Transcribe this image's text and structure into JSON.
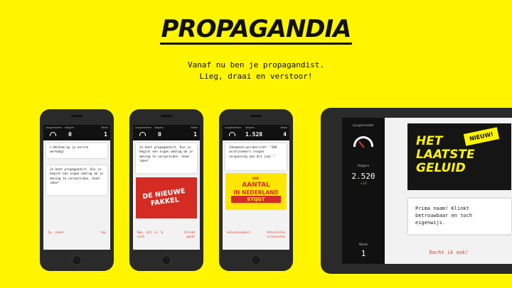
{
  "header": {
    "logo": "PROPAGANDIA",
    "tagline_line1": "Vanaf nu ben je propagandist.",
    "tagline_line2": "Lieg, draai en verstoor!"
  },
  "phones": [
    {
      "stats": {
        "leugenmeter_label": "Leugenmeter",
        "volgers_label": "Volgers",
        "volgers_value": "0",
        "week_label": "Week",
        "week_value": "1"
      },
      "cards": [
        "☺ Welkom op je eerste werkdag!",
        "Je bent propagandist. Dus je begint een eigen weblog om je mening te verspreiden. Goed idee?"
      ],
      "actions": {
        "left": "Ja, zeker",
        "right": "Yep"
      }
    },
    {
      "stats": {
        "leugenmeter_label": "Leugenmeter",
        "volgers_label": "Volgers",
        "volgers_value": "0",
        "week_label": "Week",
        "week_value": "1"
      },
      "cards": [
        "Je bent propagandist. Dus je begint een eigen weblog om je mening te verspreiden. Goed idee?"
      ],
      "poster": {
        "line1": "DE NIEUWE",
        "line2": "FAKKEL"
      },
      "actions": {
        "left": "Nee, dit is 'm niet",
        "right": "Klinkt goed!"
      }
    },
    {
      "stats": {
        "leugenmeter_label": "Leugenmeter",
        "volgers_label": "Volgers",
        "volgers_value": "1.528",
        "week_label": "Week",
        "week_value": "4"
      },
      "cards": [
        "Inkomend persbericht! \"300 asielzoekers vragen vergunning aan dit jaar.\""
      ],
      "poster": {
        "tag": "DNF",
        "line1": "AANTAL",
        "line2": "IN NEDERLAND",
        "line3": "STIJGT"
      },
      "actions": {
        "left": "Geluckzoekers",
        "right": "Potentiële criminelen"
      }
    }
  ],
  "tablet": {
    "leugenmeter_label": "Leugenmeter",
    "volgers_label": "Volgers",
    "volgers_value": "2.520",
    "volgers_delta": "+10",
    "week_label": "Week",
    "week_value": "1",
    "poster": {
      "line1": "HET",
      "line2": "LAATSTE",
      "line3": "GELUID",
      "badge": "NIEUW!"
    },
    "card": "Prima naam! Klinkt betrouwbaar en toch eigenwijs.",
    "action": "Dacht ik ook!"
  },
  "colors": {
    "background": "#fff500",
    "accent": "#e5382a",
    "dark": "#111111"
  }
}
